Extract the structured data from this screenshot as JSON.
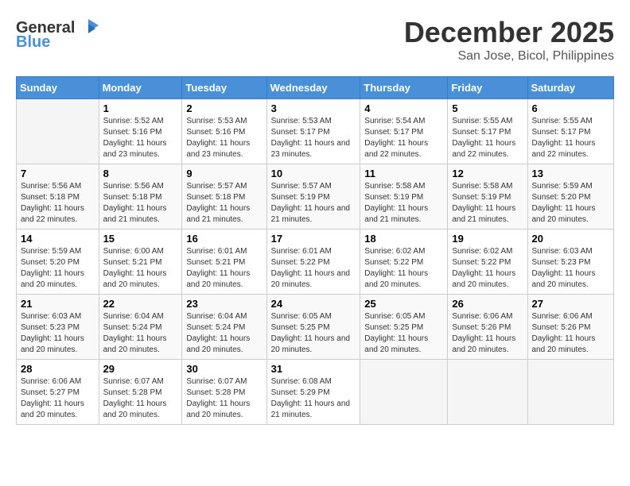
{
  "header": {
    "logo_general": "General",
    "logo_blue": "Blue",
    "title": "December 2025",
    "subtitle": "San Jose, Bicol, Philippines"
  },
  "calendar": {
    "days_of_week": [
      "Sunday",
      "Monday",
      "Tuesday",
      "Wednesday",
      "Thursday",
      "Friday",
      "Saturday"
    ],
    "weeks": [
      [
        {
          "day": "",
          "sunrise": "",
          "sunset": "",
          "daylight": ""
        },
        {
          "day": "1",
          "sunrise": "Sunrise: 5:52 AM",
          "sunset": "Sunset: 5:16 PM",
          "daylight": "Daylight: 11 hours and 23 minutes."
        },
        {
          "day": "2",
          "sunrise": "Sunrise: 5:53 AM",
          "sunset": "Sunset: 5:16 PM",
          "daylight": "Daylight: 11 hours and 23 minutes."
        },
        {
          "day": "3",
          "sunrise": "Sunrise: 5:53 AM",
          "sunset": "Sunset: 5:17 PM",
          "daylight": "Daylight: 11 hours and 23 minutes."
        },
        {
          "day": "4",
          "sunrise": "Sunrise: 5:54 AM",
          "sunset": "Sunset: 5:17 PM",
          "daylight": "Daylight: 11 hours and 22 minutes."
        },
        {
          "day": "5",
          "sunrise": "Sunrise: 5:55 AM",
          "sunset": "Sunset: 5:17 PM",
          "daylight": "Daylight: 11 hours and 22 minutes."
        },
        {
          "day": "6",
          "sunrise": "Sunrise: 5:55 AM",
          "sunset": "Sunset: 5:17 PM",
          "daylight": "Daylight: 11 hours and 22 minutes."
        }
      ],
      [
        {
          "day": "7",
          "sunrise": "Sunrise: 5:56 AM",
          "sunset": "Sunset: 5:18 PM",
          "daylight": "Daylight: 11 hours and 22 minutes."
        },
        {
          "day": "8",
          "sunrise": "Sunrise: 5:56 AM",
          "sunset": "Sunset: 5:18 PM",
          "daylight": "Daylight: 11 hours and 21 minutes."
        },
        {
          "day": "9",
          "sunrise": "Sunrise: 5:57 AM",
          "sunset": "Sunset: 5:18 PM",
          "daylight": "Daylight: 11 hours and 21 minutes."
        },
        {
          "day": "10",
          "sunrise": "Sunrise: 5:57 AM",
          "sunset": "Sunset: 5:19 PM",
          "daylight": "Daylight: 11 hours and 21 minutes."
        },
        {
          "day": "11",
          "sunrise": "Sunrise: 5:58 AM",
          "sunset": "Sunset: 5:19 PM",
          "daylight": "Daylight: 11 hours and 21 minutes."
        },
        {
          "day": "12",
          "sunrise": "Sunrise: 5:58 AM",
          "sunset": "Sunset: 5:19 PM",
          "daylight": "Daylight: 11 hours and 21 minutes."
        },
        {
          "day": "13",
          "sunrise": "Sunrise: 5:59 AM",
          "sunset": "Sunset: 5:20 PM",
          "daylight": "Daylight: 11 hours and 20 minutes."
        }
      ],
      [
        {
          "day": "14",
          "sunrise": "Sunrise: 5:59 AM",
          "sunset": "Sunset: 5:20 PM",
          "daylight": "Daylight: 11 hours and 20 minutes."
        },
        {
          "day": "15",
          "sunrise": "Sunrise: 6:00 AM",
          "sunset": "Sunset: 5:21 PM",
          "daylight": "Daylight: 11 hours and 20 minutes."
        },
        {
          "day": "16",
          "sunrise": "Sunrise: 6:01 AM",
          "sunset": "Sunset: 5:21 PM",
          "daylight": "Daylight: 11 hours and 20 minutes."
        },
        {
          "day": "17",
          "sunrise": "Sunrise: 6:01 AM",
          "sunset": "Sunset: 5:22 PM",
          "daylight": "Daylight: 11 hours and 20 minutes."
        },
        {
          "day": "18",
          "sunrise": "Sunrise: 6:02 AM",
          "sunset": "Sunset: 5:22 PM",
          "daylight": "Daylight: 11 hours and 20 minutes."
        },
        {
          "day": "19",
          "sunrise": "Sunrise: 6:02 AM",
          "sunset": "Sunset: 5:22 PM",
          "daylight": "Daylight: 11 hours and 20 minutes."
        },
        {
          "day": "20",
          "sunrise": "Sunrise: 6:03 AM",
          "sunset": "Sunset: 5:23 PM",
          "daylight": "Daylight: 11 hours and 20 minutes."
        }
      ],
      [
        {
          "day": "21",
          "sunrise": "Sunrise: 6:03 AM",
          "sunset": "Sunset: 5:23 PM",
          "daylight": "Daylight: 11 hours and 20 minutes."
        },
        {
          "day": "22",
          "sunrise": "Sunrise: 6:04 AM",
          "sunset": "Sunset: 5:24 PM",
          "daylight": "Daylight: 11 hours and 20 minutes."
        },
        {
          "day": "23",
          "sunrise": "Sunrise: 6:04 AM",
          "sunset": "Sunset: 5:24 PM",
          "daylight": "Daylight: 11 hours and 20 minutes."
        },
        {
          "day": "24",
          "sunrise": "Sunrise: 6:05 AM",
          "sunset": "Sunset: 5:25 PM",
          "daylight": "Daylight: 11 hours and 20 minutes."
        },
        {
          "day": "25",
          "sunrise": "Sunrise: 6:05 AM",
          "sunset": "Sunset: 5:25 PM",
          "daylight": "Daylight: 11 hours and 20 minutes."
        },
        {
          "day": "26",
          "sunrise": "Sunrise: 6:06 AM",
          "sunset": "Sunset: 5:26 PM",
          "daylight": "Daylight: 11 hours and 20 minutes."
        },
        {
          "day": "27",
          "sunrise": "Sunrise: 6:06 AM",
          "sunset": "Sunset: 5:26 PM",
          "daylight": "Daylight: 11 hours and 20 minutes."
        }
      ],
      [
        {
          "day": "28",
          "sunrise": "Sunrise: 6:06 AM",
          "sunset": "Sunset: 5:27 PM",
          "daylight": "Daylight: 11 hours and 20 minutes."
        },
        {
          "day": "29",
          "sunrise": "Sunrise: 6:07 AM",
          "sunset": "Sunset: 5:28 PM",
          "daylight": "Daylight: 11 hours and 20 minutes."
        },
        {
          "day": "30",
          "sunrise": "Sunrise: 6:07 AM",
          "sunset": "Sunset: 5:28 PM",
          "daylight": "Daylight: 11 hours and 20 minutes."
        },
        {
          "day": "31",
          "sunrise": "Sunrise: 6:08 AM",
          "sunset": "Sunset: 5:29 PM",
          "daylight": "Daylight: 11 hours and 21 minutes."
        },
        {
          "day": "",
          "sunrise": "",
          "sunset": "",
          "daylight": ""
        },
        {
          "day": "",
          "sunrise": "",
          "sunset": "",
          "daylight": ""
        },
        {
          "day": "",
          "sunrise": "",
          "sunset": "",
          "daylight": ""
        }
      ]
    ]
  }
}
